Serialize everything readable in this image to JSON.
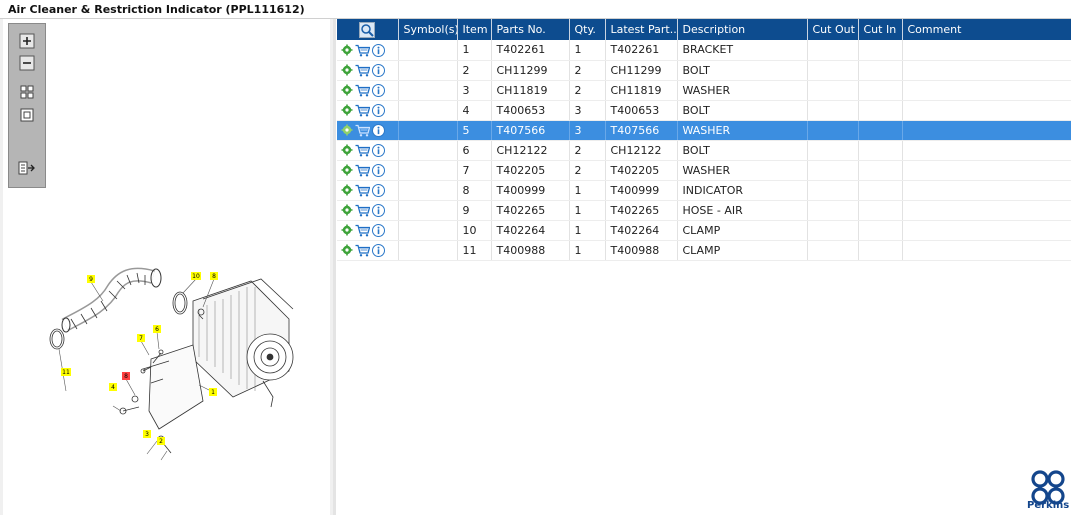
{
  "window": {
    "title": "Air Cleaner & Restriction Indicator (PPL111612)"
  },
  "toolbar": {
    "buttons": [
      "zoom-in-icon",
      "zoom-out-icon",
      "fit-all-icon",
      "actual-size-icon",
      "export-list-icon"
    ]
  },
  "drawing": {
    "callouts": [
      "9",
      "10",
      "8",
      "6",
      "7",
      "11",
      "8",
      "4",
      "1",
      "3",
      "2"
    ]
  },
  "grid": {
    "columns": [
      "",
      "Symbol(s)",
      "Item",
      "Parts No.",
      "Qty.",
      "Latest Part...",
      "Description",
      "Cut Out",
      "Cut In",
      "Comment"
    ],
    "rows": [
      {
        "item": "1",
        "part_no": "T402261",
        "qty": "1",
        "latest": "T402261",
        "desc": "BRACKET"
      },
      {
        "item": "2",
        "part_no": "CH11299",
        "qty": "2",
        "latest": "CH11299",
        "desc": "BOLT"
      },
      {
        "item": "3",
        "part_no": "CH11819",
        "qty": "2",
        "latest": "CH11819",
        "desc": "WASHER"
      },
      {
        "item": "4",
        "part_no": "T400653",
        "qty": "3",
        "latest": "T400653",
        "desc": "BOLT"
      },
      {
        "item": "5",
        "part_no": "T407566",
        "qty": "3",
        "latest": "T407566",
        "desc": "WASHER"
      },
      {
        "item": "6",
        "part_no": "CH12122",
        "qty": "2",
        "latest": "CH12122",
        "desc": "BOLT"
      },
      {
        "item": "7",
        "part_no": "T402205",
        "qty": "2",
        "latest": "T402205",
        "desc": "WASHER"
      },
      {
        "item": "8",
        "part_no": "T400999",
        "qty": "1",
        "latest": "T400999",
        "desc": "INDICATOR"
      },
      {
        "item": "9",
        "part_no": "T402265",
        "qty": "1",
        "latest": "T402265",
        "desc": "HOSE - AIR"
      },
      {
        "item": "10",
        "part_no": "T402264",
        "qty": "1",
        "latest": "T402264",
        "desc": "CLAMP"
      },
      {
        "item": "11",
        "part_no": "T400988",
        "qty": "1",
        "latest": "T400988",
        "desc": "CLAMP"
      }
    ],
    "selected_item": "5"
  },
  "brand": {
    "name": "Perkins",
    "color": "#14468c"
  },
  "colors": {
    "header_bg": "#0d4c8f",
    "selected_row": "#3c8ee0",
    "callout_yellow": "#ffff00",
    "callout_red": "#ff4040"
  }
}
